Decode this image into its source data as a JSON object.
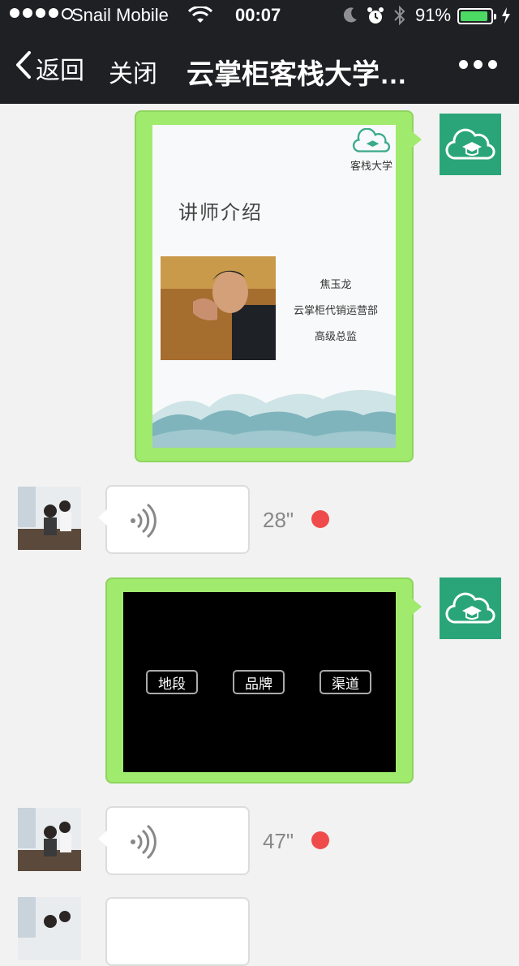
{
  "status_bar": {
    "carrier": "Snail Mobile",
    "time": "00:07",
    "battery_percent": "91%",
    "battery_level": 0.91,
    "icons": [
      "signal-dots-icon",
      "wifi-icon",
      "moon-icon",
      "alarm-icon",
      "bluetooth-icon",
      "battery-icon",
      "charging-icon"
    ]
  },
  "nav": {
    "back_label": "返回",
    "close_label": "关闭",
    "title": "云掌柜客栈大学…",
    "more_icon": "more-icon"
  },
  "messages": [
    {
      "type": "image",
      "sender": "self",
      "slide": {
        "brand_text": "客栈大学",
        "heading": "讲师介绍",
        "info_lines": [
          "焦玉龙",
          "云掌柜代销运营部",
          "高级总监"
        ]
      }
    },
    {
      "type": "voice",
      "sender": "other",
      "duration": "28\"",
      "unread": true
    },
    {
      "type": "image",
      "sender": "self",
      "slide": {
        "tags": [
          "地段",
          "品牌",
          "渠道"
        ]
      }
    },
    {
      "type": "voice",
      "sender": "other",
      "duration": "47\"",
      "unread": true
    },
    {
      "type": "voice",
      "sender": "other",
      "duration": "",
      "unread": false
    }
  ],
  "colors": {
    "nav_bg": "#1f2024",
    "chat_bg": "#f2f2f2",
    "self_bubble": "#a0ea6e",
    "logo_green": "#2aa57a",
    "unread_dot": "#f04b4b",
    "battery_fill": "#4cd964"
  }
}
